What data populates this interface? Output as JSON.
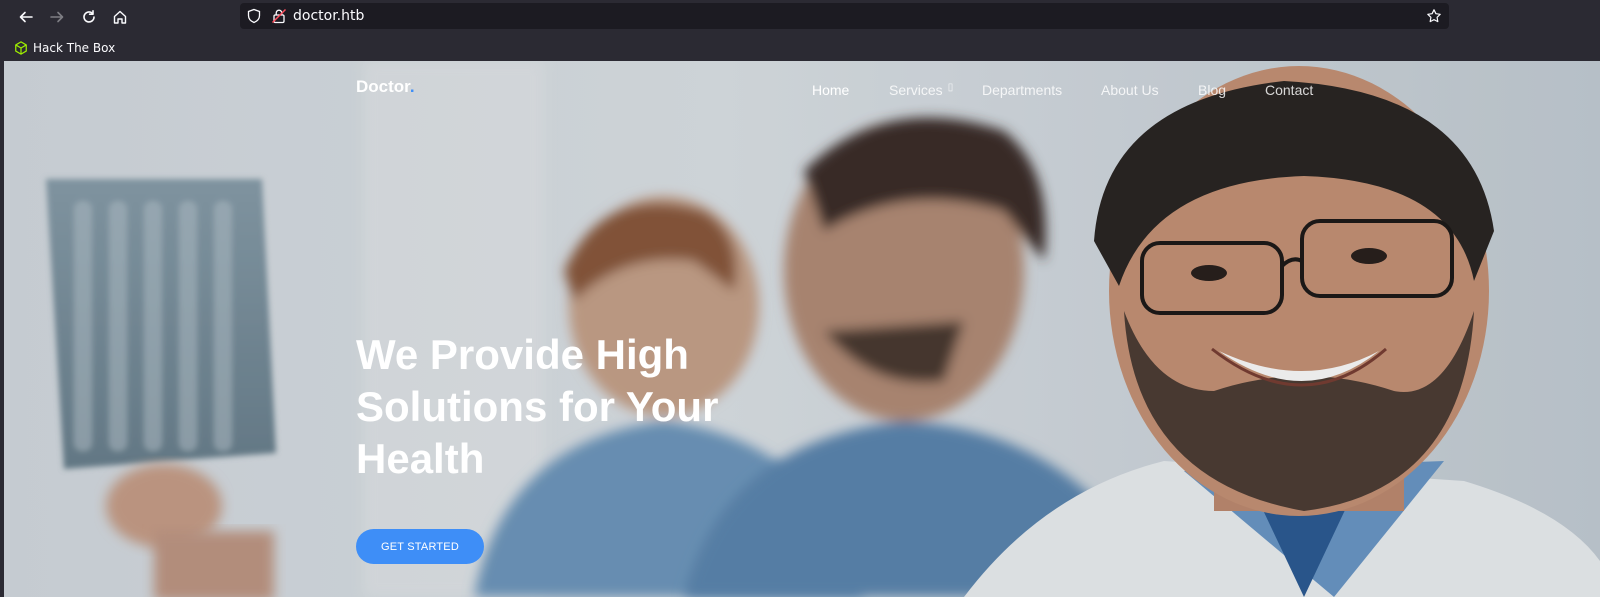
{
  "browser": {
    "url": "doctor.htb",
    "bookmarks": [
      {
        "label": "Hack The Box",
        "icon": "hackthebox-cube-icon",
        "color": "#9fef00"
      }
    ]
  },
  "site": {
    "brand": "Doctor",
    "brand_dot": ".",
    "nav": [
      {
        "label": "Home",
        "active": true
      },
      {
        "label": "Services",
        "has_dropdown": true
      },
      {
        "label": "Departments"
      },
      {
        "label": "About Us"
      },
      {
        "label": "Blog"
      },
      {
        "label": "Contact"
      }
    ],
    "hero": {
      "title_lines": [
        "We Provide High",
        "Solutions for Your",
        "Health"
      ],
      "cta_label": "GET STARTED"
    }
  },
  "colors": {
    "accent": "#3e8ef7",
    "chrome_bg": "#2b2a33",
    "urlbar_bg": "#1c1b22"
  }
}
